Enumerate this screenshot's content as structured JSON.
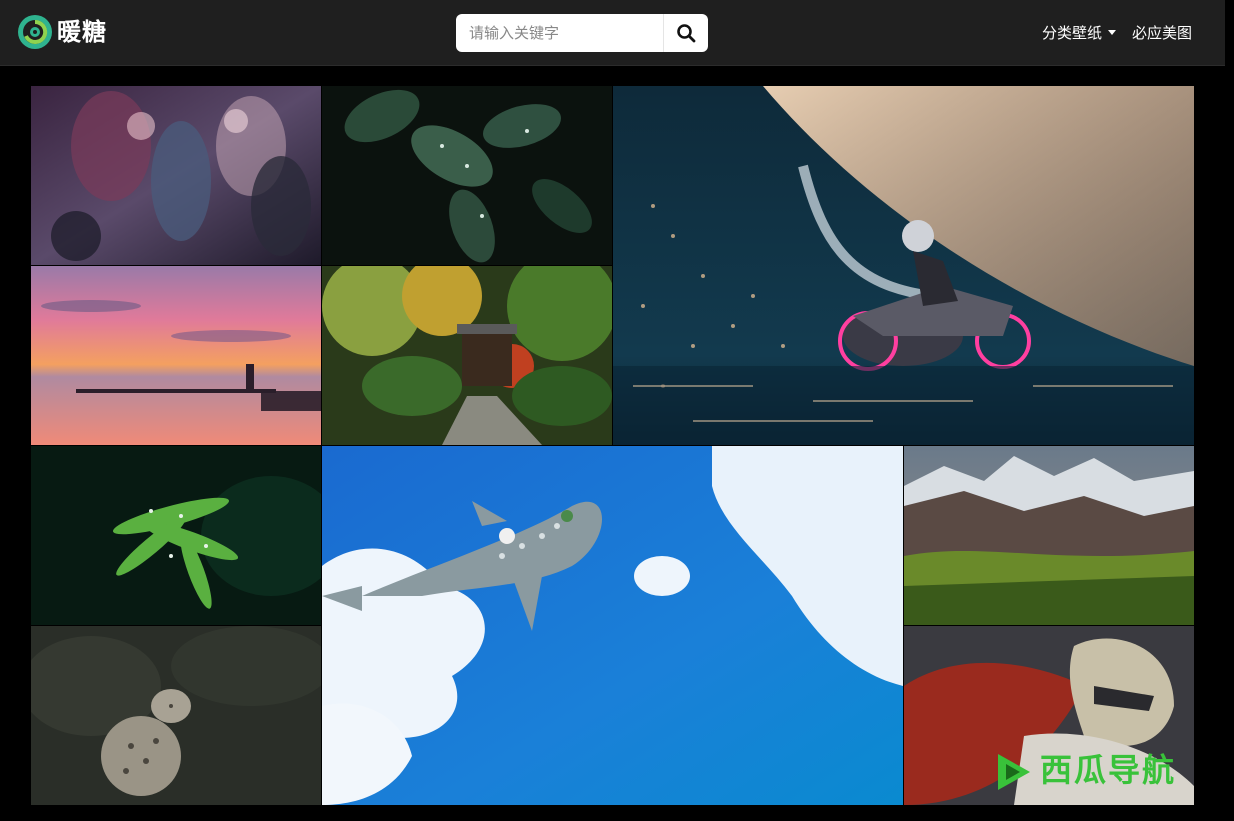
{
  "header": {
    "logo_text": "暖糖",
    "search_placeholder": "请输入关键字",
    "nav": [
      {
        "label": "分类壁纸",
        "has_dropdown": true
      },
      {
        "label": "必应美图",
        "has_dropdown": false
      }
    ]
  },
  "gallery": {
    "tiles": [
      {
        "subject": "league-of-legends-heroes"
      },
      {
        "subject": "dewy-leaves"
      },
      {
        "subject": "motorcycle-rider-city-lights"
      },
      {
        "subject": "pink-sunset-lighthouse-pier"
      },
      {
        "subject": "japanese-temple-gate"
      },
      {
        "subject": "fern-with-droplets"
      },
      {
        "subject": "whale-shark-in-sky"
      },
      {
        "subject": "mountain-landscape"
      },
      {
        "subject": "snow-leopard"
      },
      {
        "subject": "armored-knight"
      }
    ]
  },
  "watermark": {
    "text": "西瓜导航"
  },
  "colors": {
    "header_bg": "#1f1f1f",
    "page_bg": "#000000",
    "accent_green": "#39c23a"
  }
}
